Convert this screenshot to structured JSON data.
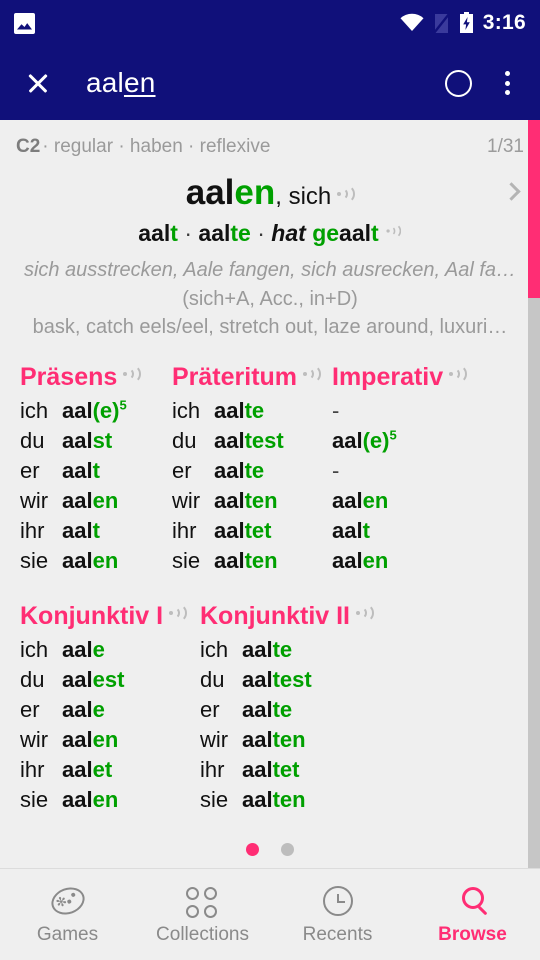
{
  "status_bar": {
    "time": "3:16",
    "icons": [
      "image-notification-icon",
      "wifi-icon",
      "no-sim-icon",
      "battery-charging-icon"
    ]
  },
  "app_bar": {
    "close_label": "close-icon",
    "title_prefix": "aal",
    "title_suffix": "en",
    "record_label": "record-icon",
    "overflow_label": "overflow-menu-icon"
  },
  "entry": {
    "level": "C2",
    "meta": " · regular · haben · reflexive",
    "counter": "1/31",
    "headword_stem": "aal",
    "headword_ending": "en",
    "headword_reflexive": ", sich",
    "parts": {
      "p1_stem": "aal",
      "p1_end": "t",
      "sep1": " · ",
      "p2_stem": "aal",
      "p2_end": "te",
      "sep2": " · ",
      "aux": "hat ",
      "p3_pre": "ge",
      "p3_stem": "aal",
      "p3_end": "t"
    },
    "definition_de": "sich ausstrecken, Aale fangen, sich ausrecken, Aal fa…",
    "valency": "(sich+A, Acc., in+D)",
    "definition_en": "bask, catch eels/eel, stretch out, laze around, luxuri…"
  },
  "tenses": [
    {
      "title": "Präsens",
      "rows": [
        {
          "pron": "ich",
          "stem": "aal",
          "paren": "(e)",
          "end": "",
          "sup": "5"
        },
        {
          "pron": "du",
          "stem": "aal",
          "end": "st"
        },
        {
          "pron": "er",
          "stem": "aal",
          "end": "t"
        },
        {
          "pron": "wir",
          "stem": "aal",
          "end": "en"
        },
        {
          "pron": "ihr",
          "stem": "aal",
          "end": "t"
        },
        {
          "pron": "sie",
          "stem": "aal",
          "end": "en"
        }
      ]
    },
    {
      "title": "Präteritum",
      "rows": [
        {
          "pron": "ich",
          "stem": "aal",
          "end": "te"
        },
        {
          "pron": "du",
          "stem": "aal",
          "end": "test"
        },
        {
          "pron": "er",
          "stem": "aal",
          "end": "te"
        },
        {
          "pron": "wir",
          "stem": "aal",
          "end": "ten"
        },
        {
          "pron": "ihr",
          "stem": "aal",
          "end": "tet"
        },
        {
          "pron": "sie",
          "stem": "aal",
          "end": "ten"
        }
      ]
    },
    {
      "title": "Imperativ",
      "rows": [
        {
          "pron": "",
          "dash": "-"
        },
        {
          "pron": "",
          "stem": "aal",
          "paren": "(e)",
          "end": "",
          "sup": "5"
        },
        {
          "pron": "",
          "dash": "-"
        },
        {
          "pron": "",
          "stem": "aal",
          "end": "en"
        },
        {
          "pron": "",
          "stem": "aal",
          "end": "t"
        },
        {
          "pron": "",
          "stem": "aal",
          "end": "en"
        }
      ]
    },
    {
      "title": "Konjunktiv I",
      "rows": [
        {
          "pron": "ich",
          "stem": "aal",
          "end": "e"
        },
        {
          "pron": "du",
          "stem": "aal",
          "end": "est"
        },
        {
          "pron": "er",
          "stem": "aal",
          "end": "e"
        },
        {
          "pron": "wir",
          "stem": "aal",
          "end": "en"
        },
        {
          "pron": "ihr",
          "stem": "aal",
          "end": "et"
        },
        {
          "pron": "sie",
          "stem": "aal",
          "end": "en"
        }
      ]
    },
    {
      "title": "Konjunktiv II",
      "rows": [
        {
          "pron": "ich",
          "stem": "aal",
          "end": "te"
        },
        {
          "pron": "du",
          "stem": "aal",
          "end": "test"
        },
        {
          "pron": "er",
          "stem": "aal",
          "end": "te"
        },
        {
          "pron": "wir",
          "stem": "aal",
          "end": "ten"
        },
        {
          "pron": "ihr",
          "stem": "aal",
          "end": "tet"
        },
        {
          "pron": "sie",
          "stem": "aal",
          "end": "ten"
        }
      ]
    }
  ],
  "pager": {
    "count": 2,
    "active_index": 0
  },
  "bottom_nav": {
    "items": [
      {
        "label": "Games",
        "icon": "gamepad-icon",
        "active": false
      },
      {
        "label": "Collections",
        "icon": "collections-icon",
        "active": false
      },
      {
        "label": "Recents",
        "icon": "clock-icon",
        "active": false
      },
      {
        "label": "Browse",
        "icon": "search-icon",
        "active": true
      }
    ]
  },
  "colors": {
    "brand_blue": "#10107a",
    "accent_pink": "#ff2d74",
    "ending_green": "#00a000",
    "background": "#efefef",
    "muted_text": "#9a9a9a"
  }
}
